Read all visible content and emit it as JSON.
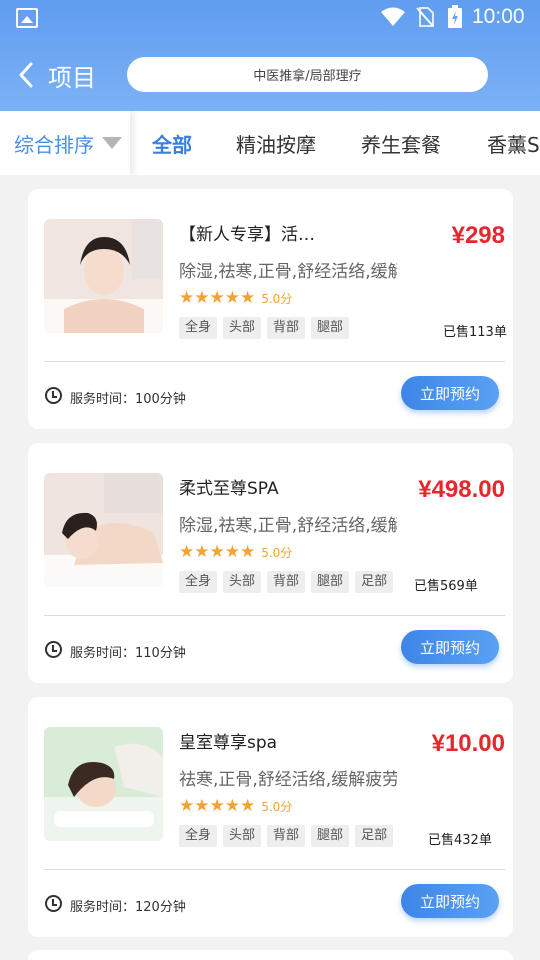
{
  "status_bar": {
    "time": "10:00"
  },
  "header": {
    "back_label": "项目",
    "search_placeholder": "中医推拿/局部理疗"
  },
  "tabs": {
    "sort_label": "综合排序",
    "items": [
      "全部",
      "精油按摩",
      "养生套餐",
      "香薰SPA"
    ]
  },
  "accent_color": "#4a90e2",
  "price_color": "#e8262d",
  "cards": [
    {
      "title": "【新人专享】活…",
      "desc": "除湿,祛寒,正骨,舒经活络,缓解疲劳",
      "rating_stars": 5,
      "score": "5.0分",
      "tags": [
        "全身",
        "头部",
        "背部",
        "腿部"
      ],
      "price": "¥298",
      "sold": "已售113单",
      "service_time": "服务时间：100分钟",
      "button": "立即预约"
    },
    {
      "title": "柔式至尊SPA",
      "desc": "除湿,祛寒,正骨,舒经活络,缓解疲劳",
      "rating_stars": 5,
      "score": "5.0分",
      "tags": [
        "全身",
        "头部",
        "背部",
        "腿部",
        "足部"
      ],
      "price": "¥498.00",
      "sold": "已售569单",
      "service_time": "服务时间：110分钟",
      "button": "立即预约"
    },
    {
      "title": "皇室尊享spa",
      "desc": "祛寒,正骨,舒经活络,缓解疲劳",
      "rating_stars": 5,
      "score": "5.0分",
      "tags": [
        "全身",
        "头部",
        "背部",
        "腿部",
        "足部"
      ],
      "price": "¥10.00",
      "sold": "已售432单",
      "service_time": "服务时间：120分钟",
      "button": "立即预约"
    }
  ]
}
